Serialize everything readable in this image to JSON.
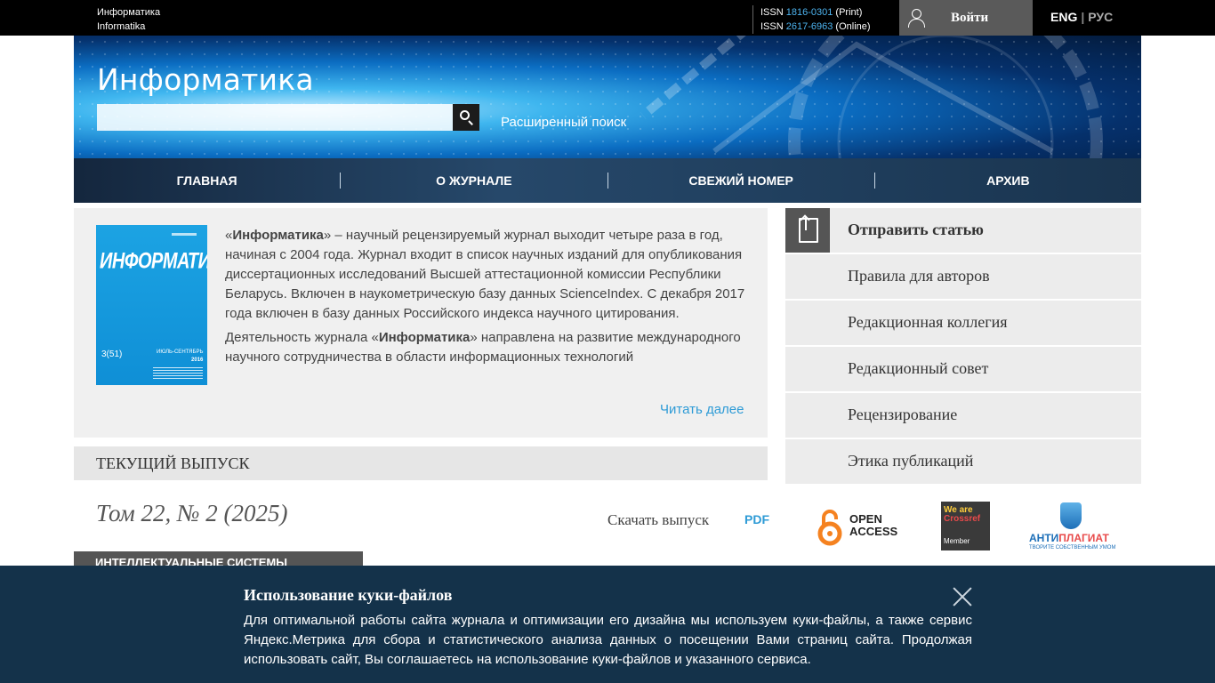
{
  "topbar": {
    "site_name_ru": "Информатика",
    "site_name_en": "Informatika",
    "issn_print_prefix": "ISSN",
    "issn_print": "1816-0301",
    "issn_print_suffix": "(Print)",
    "issn_online_prefix": "ISSN",
    "issn_online": "2617-6963",
    "issn_online_suffix": "(Online)",
    "login_label": "Войти",
    "lang_eng": "ENG",
    "lang_sep": "|",
    "lang_rus": "РУС"
  },
  "banner": {
    "title": "Информатика",
    "search_value": "",
    "advanced_search": "Расширенный поиск"
  },
  "nav": {
    "items": [
      "ГЛАВНАЯ",
      "О ЖУРНАЛЕ",
      "СВЕЖИЙ НОМЕР",
      "АРХИВ"
    ]
  },
  "about": {
    "cover_title": "ИНФОРМАТИКА",
    "cover_issue": "3(51)",
    "cover_date": "ИЮЛЬ-СЕНТЯБРЬ",
    "cover_year": "2016",
    "p1_open": "«",
    "p1_bold": "Информатика",
    "p1_rest": "» – научный рецензируемый журнал  выходит четыре раза в год, начиная с 2004 года. Журнал входит в список научных изданий для опубликования диссертационных исследований Высшей аттестационной комиссии Республики Беларусь. Включен в наукометрическую базу данных ScienceIndex. С декабря 2017 года включен в базу данных Российского индекса научного цитирования.",
    "p2_start": "Деятельность журнала «",
    "p2_bold": "Информатика",
    "p2_rest": "» направлена на развитие международного научного сотрудничества в области информационных технологий",
    "read_more": "Читать далее"
  },
  "current_issue": {
    "header": "ТЕКУЩИЙ ВЫПУСК",
    "title": "Том 22, № 2 (2025)",
    "download_label": "Скачать выпуск",
    "pdf_label": "PDF",
    "section_label": "ИНТЕЛЛЕКТУАЛЬНЫЕ СИСТЕМЫ"
  },
  "right_menu": {
    "items": [
      "Отправить статью",
      "Правила для авторов",
      "Редакционная коллегия",
      "Редакционный совет",
      "Рецензирование",
      "Этика публикаций"
    ]
  },
  "logos": {
    "open_access_line1": "OPEN",
    "open_access_line2": "ACCESS",
    "crossref_line1": "We are",
    "crossref_line2": "Crossref",
    "crossref_line3": "Member",
    "antiplagiat_a": "АНТИ",
    "antiplagiat_b": "ПЛАГИАТ",
    "antiplagiat_sub": "ТВОРИТЕ СОБСТВЕННЫМ УМОМ"
  },
  "cookie": {
    "title": "Использование куки-файлов",
    "text": "Для оптимальной работы сайта журнала и оптимизации его дизайна мы используем куки-файлы, а также сервис Яндекс.Метрика для сбора и статистического анализа данных о посещении Вами страниц сайта. Продолжая использовать сайт, Вы соглашаетесь на использование куки-файлов и указанного сервиса."
  },
  "colors": {
    "accent_link": "#2e9bd6",
    "topbar_bg": "#000000",
    "cookie_bg": "#14324a"
  }
}
